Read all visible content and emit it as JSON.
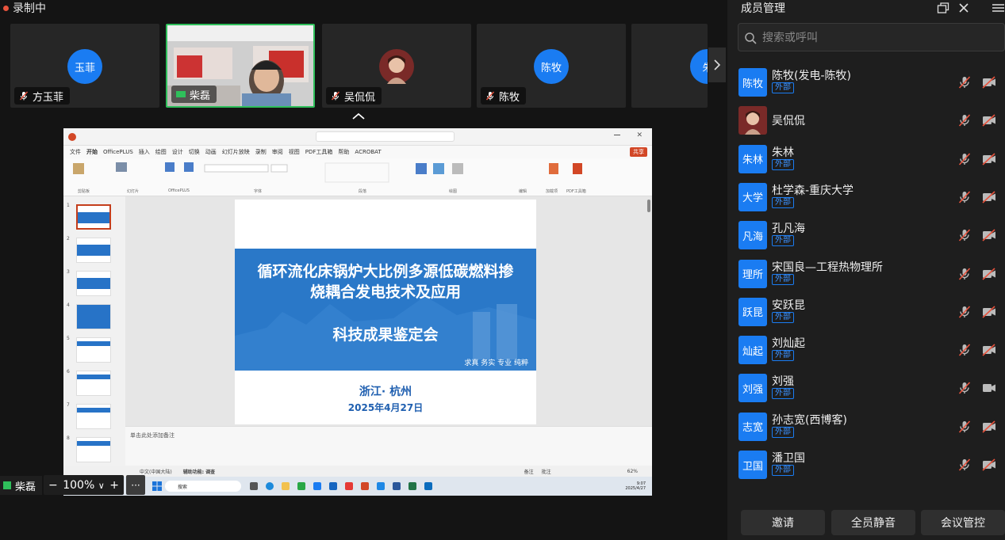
{
  "status": {
    "recording": "录制中"
  },
  "participants_strip": [
    {
      "avatar": "玉菲",
      "name": "方玉菲"
    },
    {
      "name": "柴磊"
    },
    {
      "name": "吴侃侃"
    },
    {
      "avatar": "陈牧",
      "name": "陈牧"
    },
    {
      "avatar": "朱"
    }
  ],
  "shared_screen": {
    "menu": [
      "文件",
      "开始",
      "OfficePLUS",
      "插入",
      "绘图",
      "设计",
      "切换",
      "动画",
      "幻灯片放映",
      "录制",
      "审阅",
      "视图",
      "PDF工具箱",
      "帮助",
      "ACROBAT"
    ],
    "share_label": "共享",
    "ribbon_groups": [
      "剪贴板",
      "幻灯片",
      "OfficePLUS",
      "字体",
      "段落",
      "绘图",
      "编辑",
      "加载项",
      "PDF工具箱"
    ],
    "slide_numbers": [
      "1",
      "2",
      "3",
      "4",
      "5",
      "6",
      "7",
      "8"
    ],
    "slide": {
      "title_line1": "循环流化床锅炉大比例多源低碳燃料掺",
      "title_line2": "烧耦合发电技术及应用",
      "subtitle": "科技成果鉴定会",
      "tagline": "求真  务实  专业  纯粹",
      "location": "浙江· 杭州",
      "date": "2025年4月27日"
    },
    "notes_placeholder": "单击此处添加备注",
    "status_left": "中文(中国大陆)",
    "status_access": "辅助功能: 调查",
    "status_notes": "备注",
    "status_comments": "批注",
    "zoom_percent": "62%",
    "taskbar_search": "搜索",
    "clock_time": "9:07",
    "clock_date": "2025/4/27"
  },
  "controls": {
    "self_name": "柴磊",
    "zoom": "100%",
    "zoom_caret": "∨",
    "zoom_minus": "−",
    "zoom_plus": "+",
    "more": "···"
  },
  "panel": {
    "title": "成员管理",
    "search_placeholder": "搜索或呼叫",
    "members": [
      {
        "avatar": "陈牧",
        "name": "陈牧(发电-陈牧)",
        "tag": "外部"
      },
      {
        "name": "吴侃侃"
      },
      {
        "avatar": "朱林",
        "name": "朱林",
        "tag": "外部"
      },
      {
        "avatar": "大学",
        "name": "杜学森-重庆大学",
        "tag": "外部"
      },
      {
        "avatar": "凡海",
        "name": "孔凡海",
        "tag": "外部"
      },
      {
        "avatar": "理所",
        "name": "宋国良—工程热物理所",
        "tag": "外部"
      },
      {
        "avatar": "跃昆",
        "name": "安跃昆",
        "tag": "外部"
      },
      {
        "avatar": "灿起",
        "name": "刘灿起",
        "tag": "外部"
      },
      {
        "avatar": "刘强",
        "name": "刘强",
        "tag": "外部"
      },
      {
        "avatar": "志宽",
        "name": "孙志宽(西博客)",
        "tag": "外部"
      },
      {
        "avatar": "卫国",
        "name": "潘卫国",
        "tag": "外部"
      }
    ],
    "buttons": {
      "invite": "邀请",
      "mute_all": "全员静音",
      "control": "会议管控"
    }
  }
}
